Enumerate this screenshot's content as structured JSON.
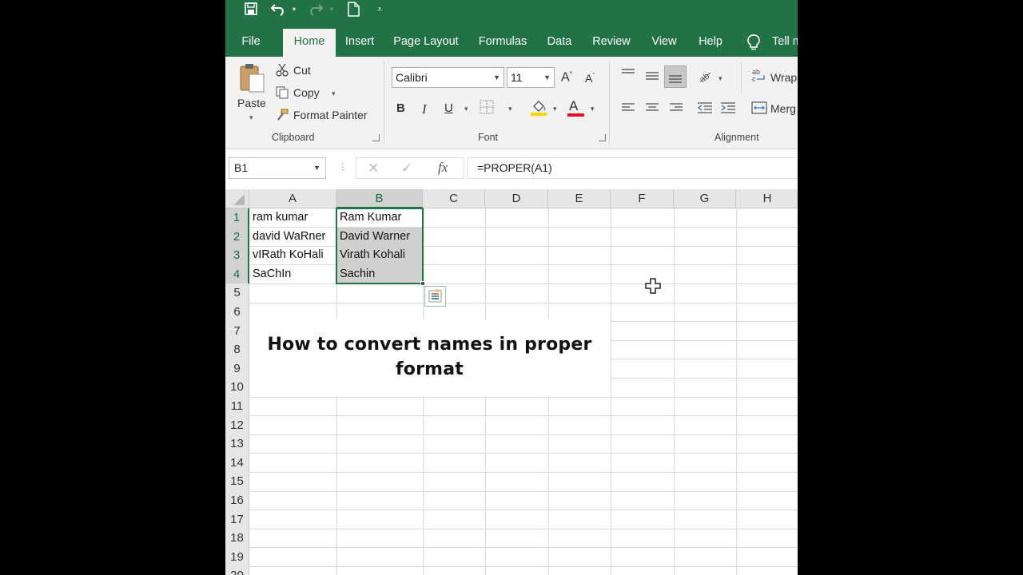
{
  "ribbon_tabs": [
    "File",
    "Home",
    "Insert",
    "Page Layout",
    "Formulas",
    "Data",
    "Review",
    "View",
    "Help",
    "Tell m"
  ],
  "active_tab": "Home",
  "clipboard": {
    "paste": "Paste",
    "cut": "Cut",
    "copy": "Copy",
    "format_painter": "Format Painter",
    "label": "Clipboard"
  },
  "font": {
    "name": "Calibri",
    "size": "11",
    "label": "Font",
    "bold": "B",
    "italic": "I",
    "underline": "U",
    "grow": "A",
    "shrink": "A",
    "font_color_letter": "A"
  },
  "alignment": {
    "wrap": "Wrap",
    "merge": "Merg",
    "label": "Alignment"
  },
  "formula_bar": {
    "name_box": "B1",
    "fx": "fx",
    "formula": "=PROPER(A1)"
  },
  "grid": {
    "columns": [
      "A",
      "B",
      "C",
      "D",
      "E",
      "F",
      "G",
      "H"
    ],
    "rows": [
      "1",
      "2",
      "3",
      "4",
      "5",
      "6",
      "7",
      "8",
      "9",
      "10",
      "11",
      "12",
      "13",
      "14",
      "15",
      "16",
      "17",
      "18",
      "19",
      "20"
    ],
    "col_a": [
      "ram kumar",
      "david WaRner",
      "vIRath KoHali",
      "SaChIn"
    ],
    "col_b": [
      "Ram Kumar",
      "David Warner",
      "Virath Kohali",
      "Sachin"
    ]
  },
  "overlay_title": {
    "line1": "How to convert names in proper",
    "line2": "format"
  },
  "colors": {
    "excel_green": "#217346",
    "ribbon_bg": "#f3f2f1",
    "selection_fill": "#d0d0d0"
  }
}
